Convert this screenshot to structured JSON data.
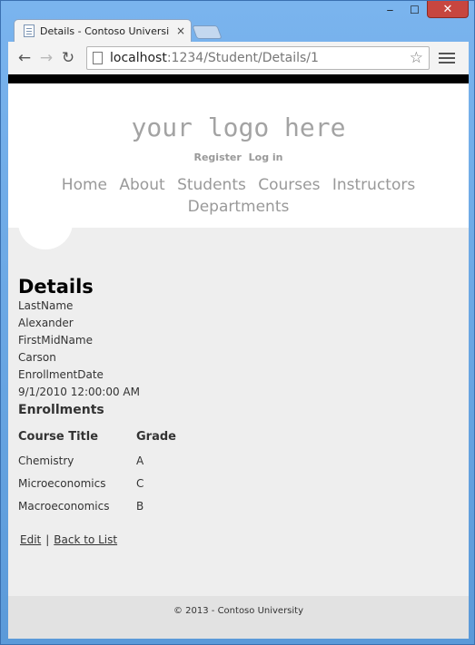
{
  "browser": {
    "tab_title": "Details - Contoso Universi",
    "url_host": "localhost",
    "url_rest": ":1234/Student/Details/1",
    "window_min": "‒",
    "window_max": "☐",
    "window_close": "✕",
    "tab_close": "×",
    "back": "←",
    "forward": "→",
    "reload": "↻",
    "star": "☆"
  },
  "header": {
    "logo": "your logo here",
    "register": "Register",
    "login": "Log in",
    "nav": [
      "Home",
      "About",
      "Students",
      "Courses",
      "Instructors",
      "Departments"
    ]
  },
  "details": {
    "title": "Details",
    "fields": [
      {
        "label": "LastName",
        "value": "Alexander"
      },
      {
        "label": "FirstMidName",
        "value": "Carson"
      },
      {
        "label": "EnrollmentDate",
        "value": "9/1/2010 12:00:00 AM"
      }
    ],
    "enrollments_heading": "Enrollments",
    "table": {
      "headers": [
        "Course Title",
        "Grade"
      ],
      "rows": [
        [
          "Chemistry",
          "A"
        ],
        [
          "Microeconomics",
          "C"
        ],
        [
          "Macroeconomics",
          "B"
        ]
      ]
    },
    "edit_link": "Edit",
    "separator": "|",
    "back_link": "Back to List"
  },
  "footer": {
    "text": "© 2013 - Contoso University"
  }
}
